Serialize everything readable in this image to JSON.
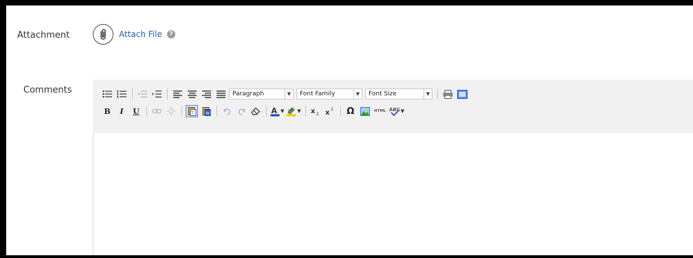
{
  "attachment": {
    "label": "Attachment",
    "link_text": "Attach File",
    "help_glyph": "?",
    "icons": {
      "clip": "paperclip-icon",
      "help": "help-icon"
    }
  },
  "comments": {
    "label": "Comments",
    "toolbar": {
      "format_select": "Paragraph",
      "font_family_select": "Font Family",
      "font_size_select": "Font Size",
      "bold": "B",
      "italic": "I",
      "underline": "U",
      "omega": "Ω",
      "html_label": "HTML"
    },
    "body_text": ""
  },
  "colors": {
    "link": "#2a5db0",
    "toolbar_bg": "#f1f1f1",
    "text_color_swatch": "#1f3fbf",
    "highlight_swatch": "#e8d000",
    "active_border": "#5a8bd1"
  }
}
